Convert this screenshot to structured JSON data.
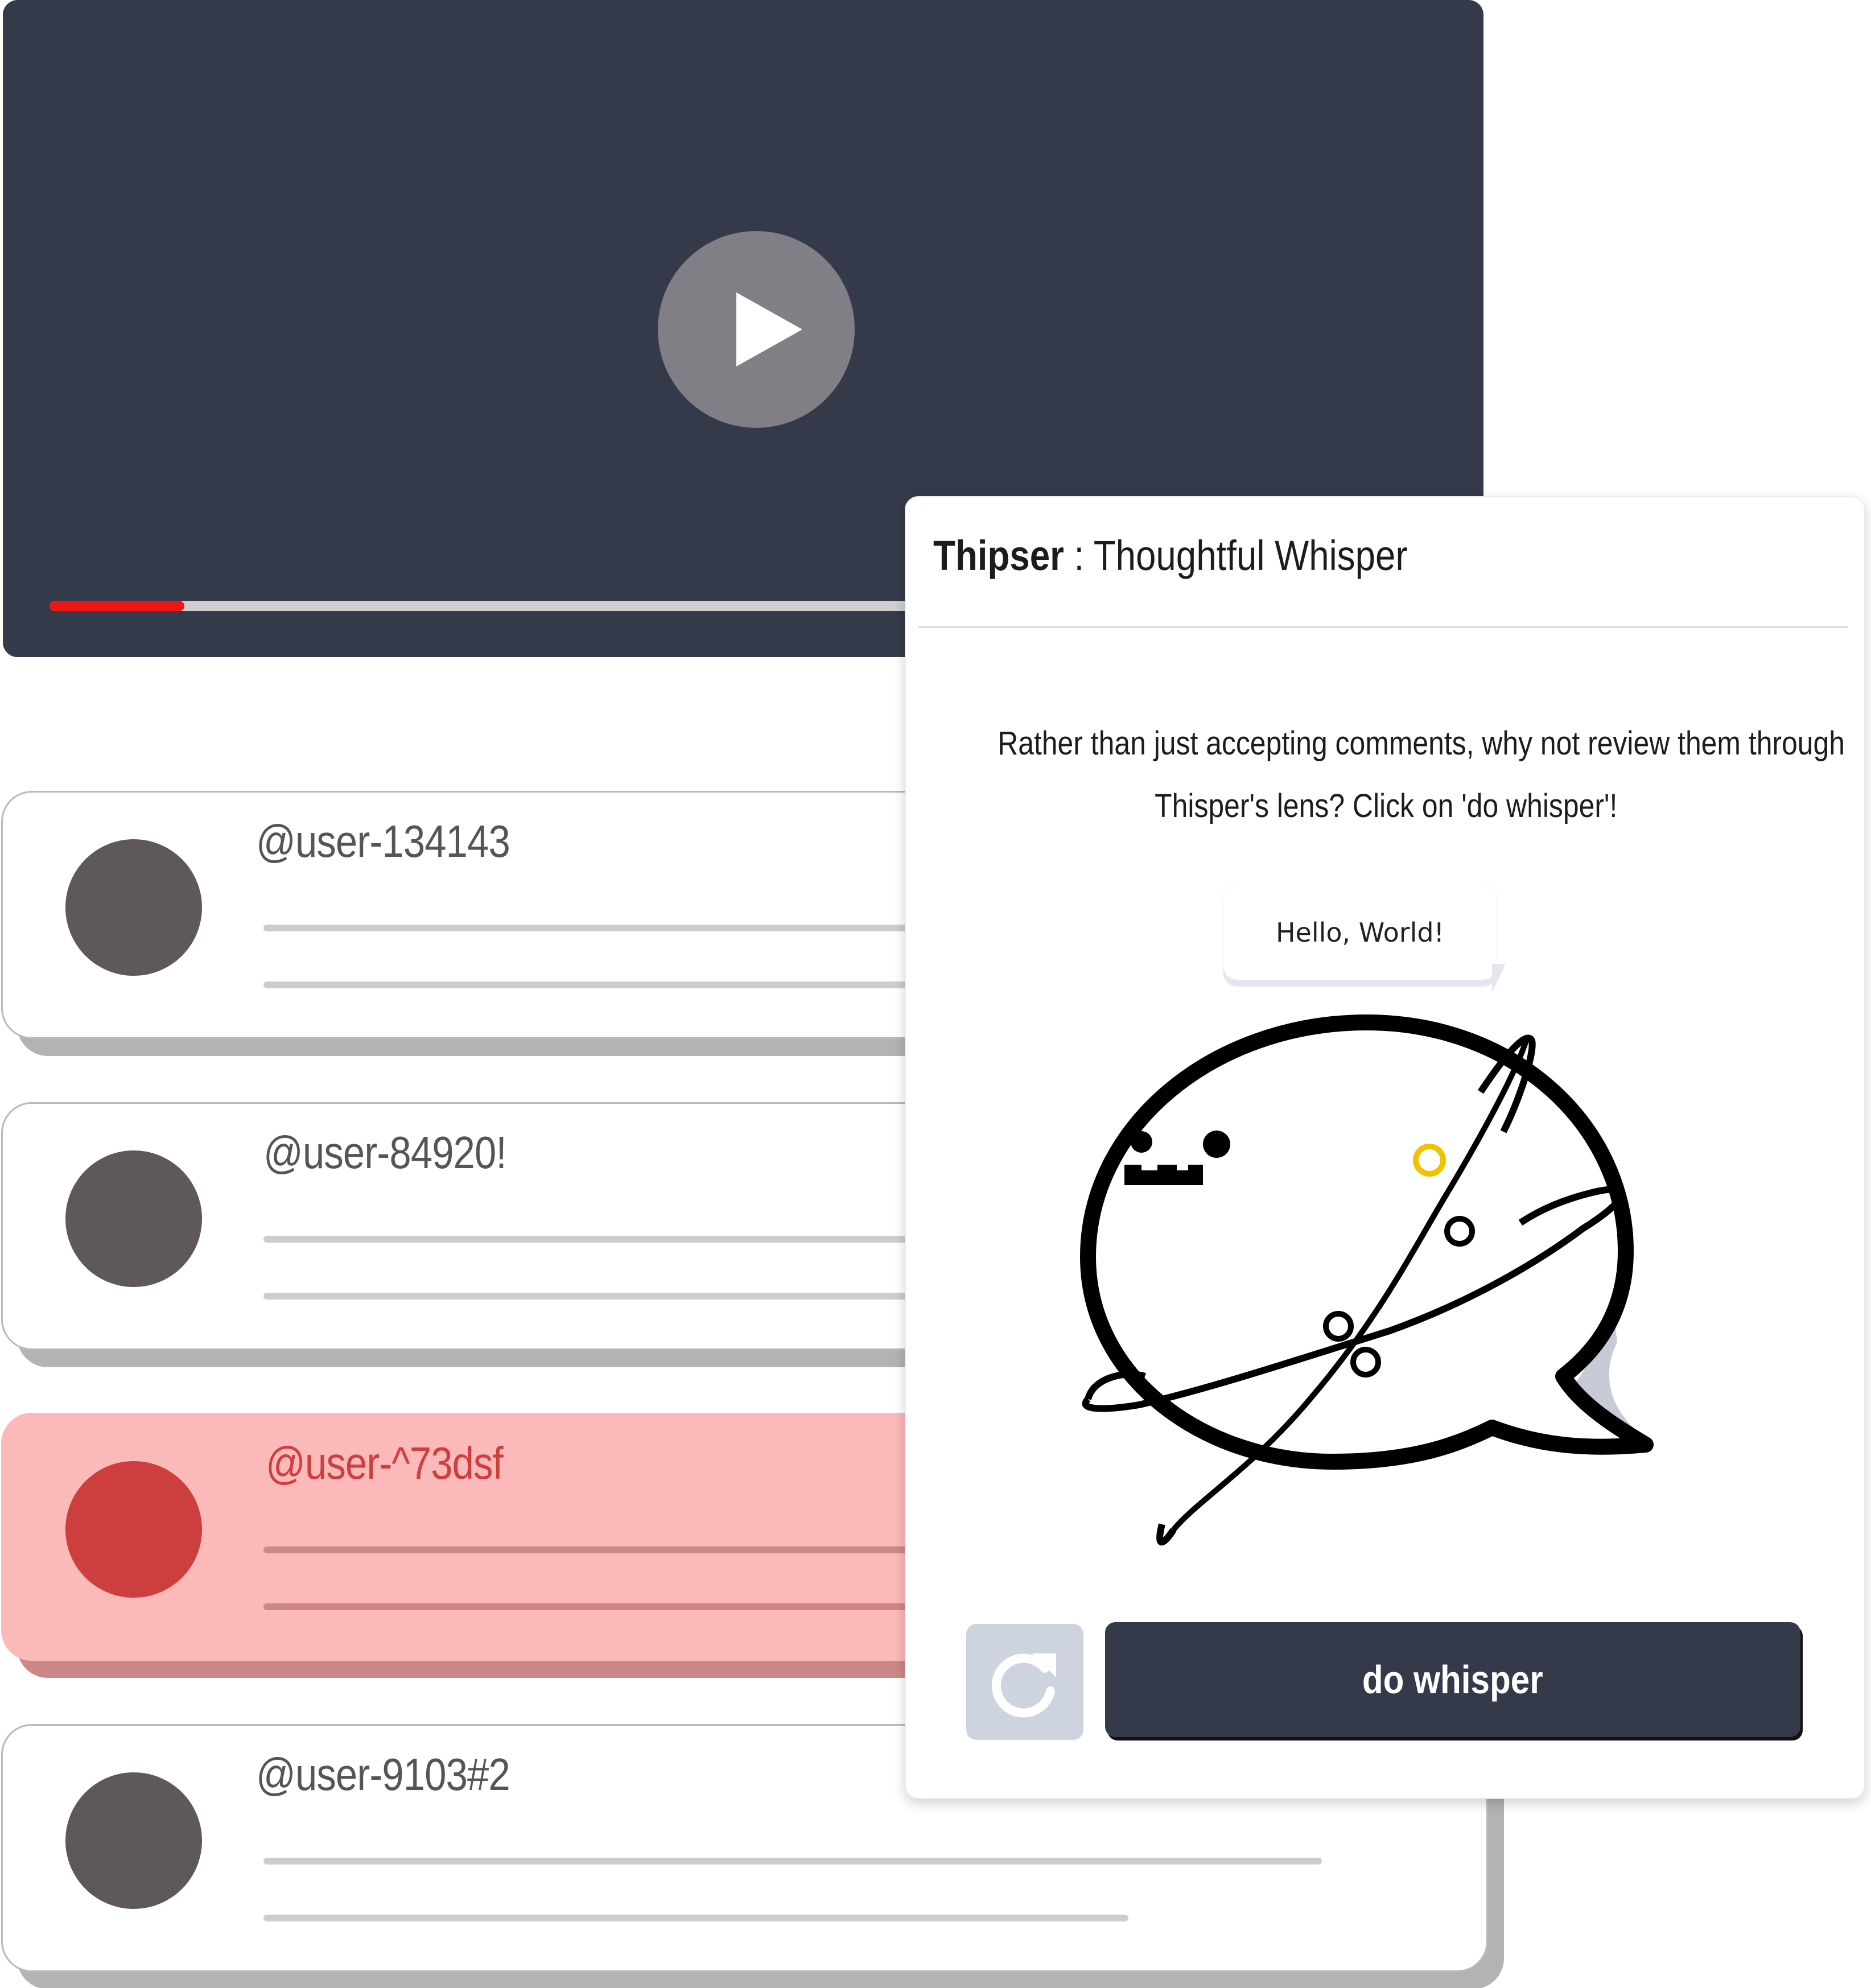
{
  "video": {
    "progress_fraction": 0.094,
    "progress_color": "#f01515",
    "background_color": "#343a4a"
  },
  "comments": [
    {
      "username": "@user-134143",
      "flagged": false
    },
    {
      "username": "@user-84920!",
      "flagged": false
    },
    {
      "username": "@user-^73dsf",
      "flagged": true
    },
    {
      "username": "@user-9103#2",
      "flagged": false
    }
  ],
  "panel": {
    "brand": "Thipser",
    "separator": " : ",
    "subtitle": "Thoughtful Whisper",
    "message_line1": "Rather than just accepting comments, why not review them through",
    "message_line2": "Thisper's lens? Click on 'do whisper'!",
    "bubble_text": "Hello, World!",
    "whisper_button_label": "do whisper",
    "refresh_icon": "refresh-icon"
  }
}
